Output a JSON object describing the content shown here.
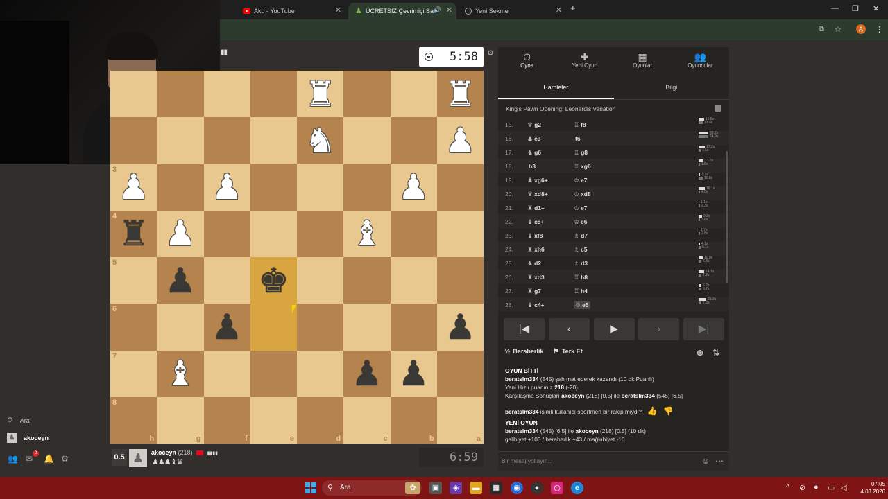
{
  "browser": {
    "tabs": [
      {
        "title": "Ako - YouTube"
      },
      {
        "title": "ÜCRETSİZ Çevrimiçi Satranç"
      },
      {
        "title": "Yeni Sekme"
      }
    ],
    "profile_initial": "A"
  },
  "sidebar": {
    "search_label": "Ara",
    "user_label": "akoceyn",
    "mail_badge": "2"
  },
  "board": {
    "ranks": [
      "",
      "",
      "3",
      "4",
      "5",
      "6",
      "7",
      "8"
    ],
    "files": [
      "h",
      "g",
      "f",
      "e",
      "d",
      "c",
      "b",
      "a"
    ],
    "rows": [
      [
        "",
        "",
        "",
        "",
        "wR",
        "",
        "",
        "wR"
      ],
      [
        "",
        "",
        "",
        "",
        "wN",
        "",
        "",
        "wP"
      ],
      [
        "wP",
        "",
        "wP",
        "",
        "",
        "",
        "wP",
        ""
      ],
      [
        "bR",
        "wP",
        "",
        "",
        "",
        "wB",
        "",
        ""
      ],
      [
        "",
        "bP",
        "",
        "bK",
        "",
        "",
        "",
        ""
      ],
      [
        "",
        "",
        "bP",
        "",
        "",
        "",
        "",
        "bP"
      ],
      [
        "",
        "wB",
        "",
        "",
        "",
        "bP",
        "bP",
        ""
      ],
      [
        "",
        "",
        "",
        "",
        "",
        "",
        "",
        ""
      ]
    ],
    "highlight": [
      [
        4,
        3
      ],
      [
        5,
        3
      ]
    ]
  },
  "clock_top": "5:58",
  "clock_bottom": "6:59",
  "player": {
    "score": "0.5",
    "name": "akoceyn",
    "rating": "(218)",
    "signal": "▮▮▮▮",
    "captured": "♟♟♟♝♛"
  },
  "panel": {
    "nav": [
      {
        "icon": "timer-icon",
        "glyph": "⏱",
        "label": "Oyna"
      },
      {
        "icon": "plus-icon",
        "glyph": "✚",
        "label": "Yeni Oyun"
      },
      {
        "icon": "board-icon",
        "glyph": "▦",
        "label": "Oyunlar"
      },
      {
        "icon": "players-icon",
        "glyph": "👥",
        "label": "Oyuncular"
      }
    ],
    "subtabs": [
      "Hamleler",
      "Bilgi"
    ],
    "opening": "King's Pawn Opening: Leonardis Variation",
    "moves": [
      {
        "n": "15.",
        "w": "g2",
        "wp": "♛",
        "b": "f8",
        "bp": "♖",
        "t": [
          "15.5s",
          "13.6s"
        ],
        "tw": [
          8,
          6
        ]
      },
      {
        "n": "16.",
        "w": "e3",
        "wp": "♟",
        "b": "f6",
        "bp": "",
        "t": [
          "26.2s",
          "24.9s"
        ],
        "tw": [
          14,
          14
        ]
      },
      {
        "n": "17.",
        "w": "g6",
        "wp": "♞",
        "b": "g8",
        "bp": "♖",
        "t": [
          "17.2s",
          "4.5s"
        ],
        "tw": [
          9,
          3
        ]
      },
      {
        "n": "18.",
        "w": "b3",
        "wp": "",
        "b": "xg6",
        "bp": "♖",
        "t": [
          "13.5s",
          "1.5s"
        ],
        "tw": [
          7,
          2
        ]
      },
      {
        "n": "19.",
        "w": "xg6+",
        "wp": "♟",
        "b": "e7",
        "bp": "♔",
        "t": [
          "3.7s",
          "10.8s"
        ],
        "tw": [
          2,
          6
        ]
      },
      {
        "n": "20.",
        "w": "xd8+",
        "wp": "♛",
        "b": "xd8",
        "bp": "♔",
        "t": [
          "16.1s",
          "4.0s"
        ],
        "tw": [
          9,
          2
        ]
      },
      {
        "n": "21.",
        "w": "d1+",
        "wp": "♜",
        "b": "e7",
        "bp": "♔",
        "t": [
          "1.1s",
          "2.3s"
        ],
        "tw": [
          1,
          2
        ]
      },
      {
        "n": "22.",
        "w": "c5+",
        "wp": "♝",
        "b": "e6",
        "bp": "♔",
        "t": [
          "9.2s",
          "3.6s"
        ],
        "tw": [
          5,
          2
        ]
      },
      {
        "n": "23.",
        "w": "xf8",
        "wp": "♝",
        "b": "d7",
        "bp": "♗",
        "t": [
          "1.7s",
          "2.8s"
        ],
        "tw": [
          1,
          2
        ]
      },
      {
        "n": "24.",
        "w": "xh6",
        "wp": "♜",
        "b": "c5",
        "bp": "♗",
        "t": [
          "4.1s",
          "5.1s"
        ],
        "tw": [
          2,
          3
        ]
      },
      {
        "n": "25.",
        "w": "d2",
        "wp": "♞",
        "b": "d3",
        "bp": "♗",
        "t": [
          "10.0s",
          "6.8s"
        ],
        "tw": [
          6,
          4
        ]
      },
      {
        "n": "26.",
        "w": "xd3",
        "wp": "♜",
        "b": "h8",
        "bp": "♖",
        "t": [
          "14.1s",
          "7.2s"
        ],
        "tw": [
          8,
          4
        ]
      },
      {
        "n": "27.",
        "w": "g7",
        "wp": "♜",
        "b": "h4",
        "bp": "♖",
        "t": [
          "6.2s",
          "6.7s"
        ],
        "tw": [
          4,
          4
        ]
      },
      {
        "n": "28.",
        "w": "c4+",
        "wp": "♝",
        "b": "e5",
        "bp": "♔",
        "t": [
          "21.3s",
          "7.3s"
        ],
        "tw": [
          11,
          4
        ]
      }
    ],
    "draw_label": "Beraberlik",
    "resign_label": "Terk Et",
    "info": {
      "game_over": "OYUN BİTTİ",
      "l1_name": "beratslm334",
      "l1_rest": "(545) şah mat ederek kazandı (10 dk Puanlı)",
      "l2_pre": "Yeni Hızlı puanınız",
      "l2_val": "218",
      "l2_post": "(-20).",
      "l3_pre": "Karşılaşma Sonuçları",
      "l3_a": "akoceyn",
      "l3_mid": "(218) [0.5] ile",
      "l3_b": "beratslm334",
      "l3_post": "(545) [6.5]",
      "question_name": "beratslm334",
      "question_rest": "isimli kullanıcı sportmen bir rakip miydi?",
      "new_game": "YENİ OYUN",
      "ng_a": "beratslm334",
      "ng_mid": "(545) [6.5] ile",
      "ng_b": "akoceyn",
      "ng_post": "(218) [0.5] (10 dk)",
      "stats": "galibiyet +103 / beraberlik +43 / mağlubiyet -16"
    },
    "message_placeholder": "Bir mesaj yollayın..."
  },
  "taskbar": {
    "search_label": "Ara",
    "time": "07:05",
    "date": "4.03.2026"
  }
}
